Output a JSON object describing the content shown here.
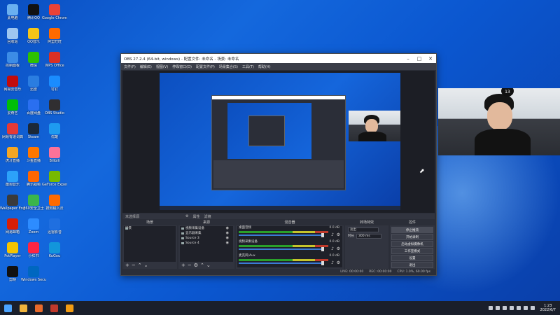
{
  "desktop": {
    "icons": [
      {
        "label": "此电脑",
        "color": "#6ab0f0"
      },
      {
        "label": "腾讯QQ",
        "color": "#111"
      },
      {
        "label": "Google Chrome",
        "color": "#e94235"
      },
      {
        "label": "回收站",
        "color": "#9ec6f0"
      },
      {
        "label": "QQ音乐",
        "color": "#f5c518"
      },
      {
        "label": "阿里旺旺",
        "color": "#ff6a00"
      },
      {
        "label": "控制面板",
        "color": "#3c8ce6"
      },
      {
        "label": "微信",
        "color": "#2dc100"
      },
      {
        "label": "WPS Office",
        "color": "#d93025"
      },
      {
        "label": "网易云音乐",
        "color": "#c20c0c"
      },
      {
        "label": "迅雷",
        "color": "#2a7de1"
      },
      {
        "label": "钉钉",
        "color": "#1a8cff"
      },
      {
        "label": "爱奇艺",
        "color": "#00be06"
      },
      {
        "label": "百度网盘",
        "color": "#2a6ff0"
      },
      {
        "label": "OBS Studio",
        "color": "#302e31"
      },
      {
        "label": "网易有道词典",
        "color": "#e53935"
      },
      {
        "label": "Steam",
        "color": "#1b2838"
      },
      {
        "label": "优酷",
        "color": "#1e9bf0"
      },
      {
        "label": "虎牙直播",
        "color": "#f5a623"
      },
      {
        "label": "斗鱼直播",
        "color": "#ff7700"
      },
      {
        "label": "Bilibili",
        "color": "#fb7299"
      },
      {
        "label": "酷狗音乐",
        "color": "#2ca2f9"
      },
      {
        "label": "腾讯视频",
        "color": "#ff6600"
      },
      {
        "label": "GeForce Experience",
        "color": "#76b900"
      },
      {
        "label": "Wallpaper Engine",
        "color": "#3a3a3a"
      },
      {
        "label": "360安全卫士",
        "color": "#3bb54a"
      },
      {
        "label": "搜狗输入法",
        "color": "#ff6a00"
      },
      {
        "label": "网易邮箱",
        "color": "#d81e06"
      },
      {
        "label": "Zoom",
        "color": "#2d8cff"
      },
      {
        "label": "迅雷影音",
        "color": "#1f6fe0"
      },
      {
        "label": "PotPlayer",
        "color": "#f5c400"
      },
      {
        "label": "小红书",
        "color": "#ff2442"
      },
      {
        "label": "KuGou",
        "color": "#1296db"
      },
      {
        "label": "剪映",
        "color": "#111111"
      },
      {
        "label": "Windows Security",
        "color": "#0067c0"
      }
    ]
  },
  "obs": {
    "title": "OBS 27.2.4 (64-bit, windows) - 配置文件: 未命名 - 场景: 未命名",
    "menu": [
      "文件(F)",
      "编辑(E)",
      "视图(V)",
      "停靠窗口(D)",
      "配置文件(P)",
      "场景集合(S)",
      "工具(T)",
      "帮助(H)"
    ],
    "docks_bar": [
      "未选择源",
      "属性",
      "滤镜"
    ],
    "scenes": {
      "header": "场景",
      "items": [
        "场景"
      ]
    },
    "sources": {
      "header": "来源",
      "items": [
        "视频采集设备",
        "显示器采集",
        "Source 3",
        "Source 4"
      ]
    },
    "mixer": {
      "header": "混音器",
      "tracks": [
        {
          "name": "桌面音频",
          "db": "0.0 dB"
        },
        {
          "name": "视频采集设备",
          "db": "0.0 dB"
        },
        {
          "name": "麦克风/Aux",
          "db": "0.0 dB"
        }
      ]
    },
    "transitions": {
      "header": "转场特效",
      "type": "淡出",
      "duration_label": "时长",
      "duration": "300 ms"
    },
    "controls": {
      "header": "控件",
      "buttons": [
        "停止推流",
        "开始录制",
        "启动虚拟摄像机",
        "工作室模式",
        "设置",
        "退出"
      ]
    },
    "status": {
      "live": "LIVE: 00:00:00",
      "rec": "REC: 00:00:00",
      "cpu": "CPU: 1.0%, 60.00 fps"
    }
  },
  "webcam": {
    "badge": "13"
  },
  "taskbar": {
    "apps": [
      {
        "name": "start",
        "color": "#4aa3ff"
      },
      {
        "name": "file-explorer",
        "color": "#f0b43c"
      },
      {
        "name": "app-orange",
        "color": "#e86a2b"
      },
      {
        "name": "obs",
        "color": "#c0392b"
      },
      {
        "name": "app-yellow",
        "color": "#f39c12"
      }
    ],
    "time": "1:23",
    "date": "2022/6/7"
  }
}
